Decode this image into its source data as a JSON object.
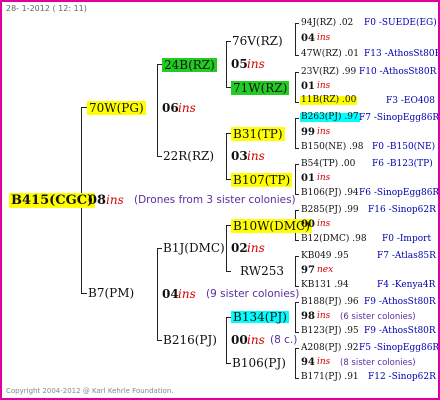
{
  "header": "28-  1-2012 ( 12: 11)",
  "footer": "Copyright 2004-2012 @ Karl Kehrle Foundation.",
  "root": {
    "name": "B415(CGC)",
    "year": "08",
    "ins": "ins",
    "note": "(Drones from 3 sister colonies)"
  },
  "g1": {
    "top": {
      "name": "70W(PG)",
      "year": "06",
      "ins": "ins"
    },
    "bottom": {
      "name": "B7(PM)",
      "year": "04",
      "ins": "ins",
      "note": "(9 sister colonies)"
    }
  },
  "g2": {
    "a": {
      "name": "24B(RZ)",
      "year": "05",
      "ins": "ins"
    },
    "b": {
      "name": "22R(RZ)",
      "year": "03",
      "ins": "ins"
    },
    "c": {
      "name": "B1J(DMC)",
      "year": "02",
      "ins": "ins"
    },
    "d": {
      "name": "B216(PJ)",
      "year": "00",
      "ins": "ins",
      "note": "(8 c.)"
    }
  },
  "g3": {
    "a1": "76V(RZ)",
    "a2": "71W(RZ)",
    "b1": "B31(TP)",
    "b2": "B107(TP)",
    "c1": "B10W(DMC)",
    "c2": "RW253",
    "d1": "B134(PJ)",
    "d2": "B106(PJ)"
  },
  "g4": [
    {
      "top": "94J(RZ) .02",
      "topr": "F0 -SUEDE(EG)",
      "mid": "04",
      "midi": "ins",
      "bot": "47W(RZ) .01",
      "botr": "F13 -AthosSt80R"
    },
    {
      "top": "23V(RZ) .99",
      "topr": "F10 -AthosSt80R",
      "mid": "01",
      "midi": "ins",
      "bot": "11B(RZ) .00",
      "botr": "F3 -EO408"
    },
    {
      "top": "B263(PJ) .97",
      "topr": "F7 -SinopEgg86R",
      "mid": "99",
      "midi": "ins",
      "bot": "B150(NE) .98",
      "botr": "F0 -B150(NE)"
    },
    {
      "top": "B54(TP) .00",
      "topr": "F6 -B123(TP)",
      "mid": "01",
      "midi": "ins",
      "bot": "B106(PJ) .94",
      "botr": "F6 -SinopEgg86R"
    },
    {
      "top": "B285(PJ) .99",
      "topr": "F16 -Sinop62R",
      "mid": "00",
      "midi": "ins",
      "bot": "B12(DMC) .98",
      "botr": "F0 -Import"
    },
    {
      "top": "KB049 .95",
      "topr": "F7 -Atlas85R",
      "mid": "97",
      "midi": "nex",
      "bot": "KB131 .94",
      "botr": "F4 -Kenya4R"
    },
    {
      "top": "B188(PJ) .96",
      "topr": "F9 -AthosSt80R",
      "mid": "98",
      "midi": "ins",
      "note": "(6 sister colonies)",
      "bot": "B123(PJ) .95",
      "botr": "F9 -AthosSt80R"
    },
    {
      "top": "A208(PJ) .92",
      "topr": "F5 -SinopEgg86R",
      "mid": "94",
      "midi": "ins",
      "note": "(8 sister colonies)",
      "bot": "B171(PJ) .91",
      "botr": "F12 -Sinop62R"
    }
  ]
}
